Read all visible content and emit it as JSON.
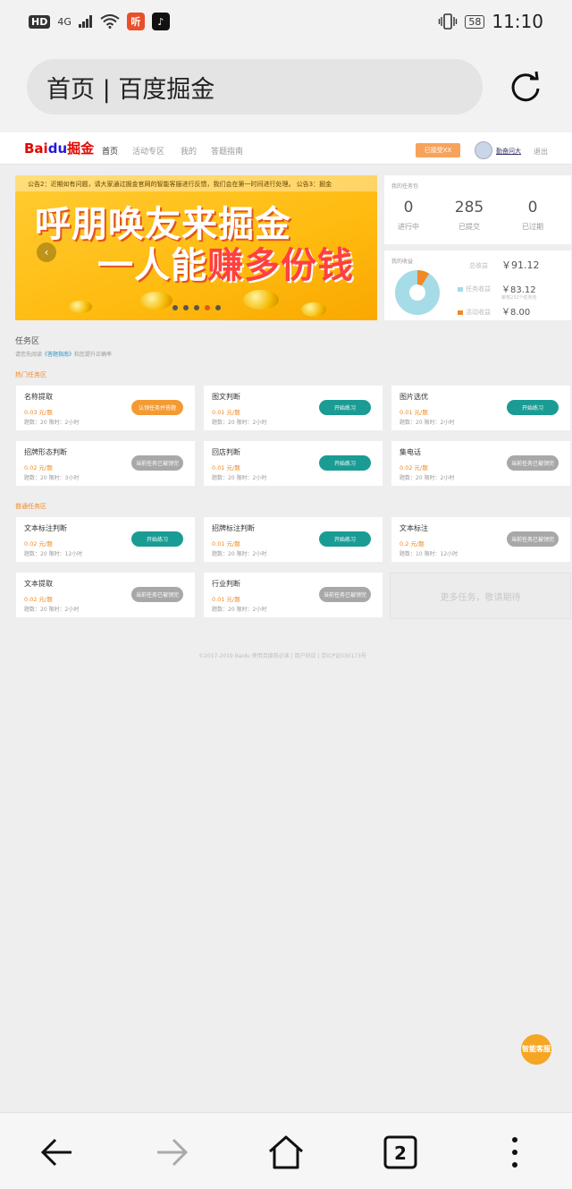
{
  "status_bar": {
    "hd": "HD",
    "signal": "4G",
    "app_icon_1": "听",
    "app_icon_2": "♪",
    "battery": "58",
    "time": "11:10"
  },
  "browser": {
    "url_title": "首页 | 百度掘金",
    "tab_count": "2"
  },
  "nav": {
    "logo_part1": "Bai",
    "logo_part2": "du",
    "logo_part3": "掘金",
    "items": [
      "首页",
      "活动专区",
      "我的",
      "答题指南"
    ],
    "badge": "已接受XX",
    "username": "勤奋问大",
    "logout": "退出"
  },
  "banner": {
    "notice": "公告2：近期如有问题，请大家通过掘金官网的智能客服进行反馈，我们会在第一时间进行处理。       公告3：掘金",
    "line1": "呼朋唤友来掘金",
    "line2_a": "一人能",
    "line2_b": "赚多份钱"
  },
  "task_stats": {
    "caption": "我的任务包",
    "items": [
      {
        "num": "0",
        "label": "进行中"
      },
      {
        "num": "285",
        "label": "已提交"
      },
      {
        "num": "0",
        "label": "已过期"
      }
    ]
  },
  "revenue": {
    "caption": "我的收益",
    "total_label": "总收益",
    "total_value": "￥91.12",
    "task_label": "任务收益",
    "task_value": "￥83.12",
    "task_note": "审核232个任务包",
    "activity_label": "活动收益",
    "activity_value": "￥8.00",
    "colors": {
      "task": "#a6dbe8",
      "activity": "#f08a24"
    }
  },
  "task_zone": {
    "title": "任务区",
    "note_prefix": "请您先阅读",
    "note_link": "《答题指南》",
    "note_suffix": "和您提升正确率",
    "hot_title": "热门任务区",
    "normal_title": "普通任务区",
    "hot_tasks": [
      {
        "name": "名称提取",
        "price": "0.03 元/题",
        "info": "题数：20   限时：2小时",
        "button": "认领任务并答题",
        "style": "orange"
      },
      {
        "name": "图文判断",
        "price": "0.01 元/题",
        "info": "题数：20   限时：2小时",
        "button": "开始练习",
        "style": "teal"
      },
      {
        "name": "图片选优",
        "price": "0.01 元/题",
        "info": "题数：20   限时：2小时",
        "button": "开始练习",
        "style": "teal"
      },
      {
        "name": "招牌形态判断",
        "price": "0.02 元/题",
        "info": "题数：20   限时：3小时",
        "button": "当前任务已被领完",
        "style": "gray"
      },
      {
        "name": "回店判断",
        "price": "0.01 元/题",
        "info": "题数：20   限时：2小时",
        "button": "开始练习",
        "style": "teal"
      },
      {
        "name": "集电话",
        "price": "0.02 元/题",
        "info": "题数：20   限时：2小时",
        "button": "当前任务已被领完",
        "style": "gray"
      }
    ],
    "normal_tasks": [
      {
        "name": "文本标注判断",
        "price": "0.02 元/题",
        "info": "题数：20   限时：12小时",
        "button": "开始练习",
        "style": "teal"
      },
      {
        "name": "招牌标注判断",
        "price": "0.01 元/题",
        "info": "题数：20   限时：2小时",
        "button": "开始练习",
        "style": "teal"
      },
      {
        "name": "文本标注",
        "price": "0.2 元/题",
        "info": "题数：10   限时：12小时",
        "button": "当前任务已被领完",
        "style": "gray"
      },
      {
        "name": "文本提取",
        "price": "0.02 元/题",
        "info": "题数：20   限时：2小时",
        "button": "当前任务已被领完",
        "style": "gray"
      },
      {
        "name": "行业判断",
        "price": "0.01 元/题",
        "info": "题数：20   限时：2小时",
        "button": "当前任务已被领完",
        "style": "gray"
      }
    ],
    "more": "更多任务，敬请期待"
  },
  "footer": "©2017-2019 Baidu 使用百度前必读  |  用户协议  |  京ICP证030173号",
  "help_button": "智能客服",
  "bottom_nav_icons": [
    "back-icon",
    "forward-icon",
    "home-icon",
    "tabs-icon",
    "more-icon"
  ]
}
